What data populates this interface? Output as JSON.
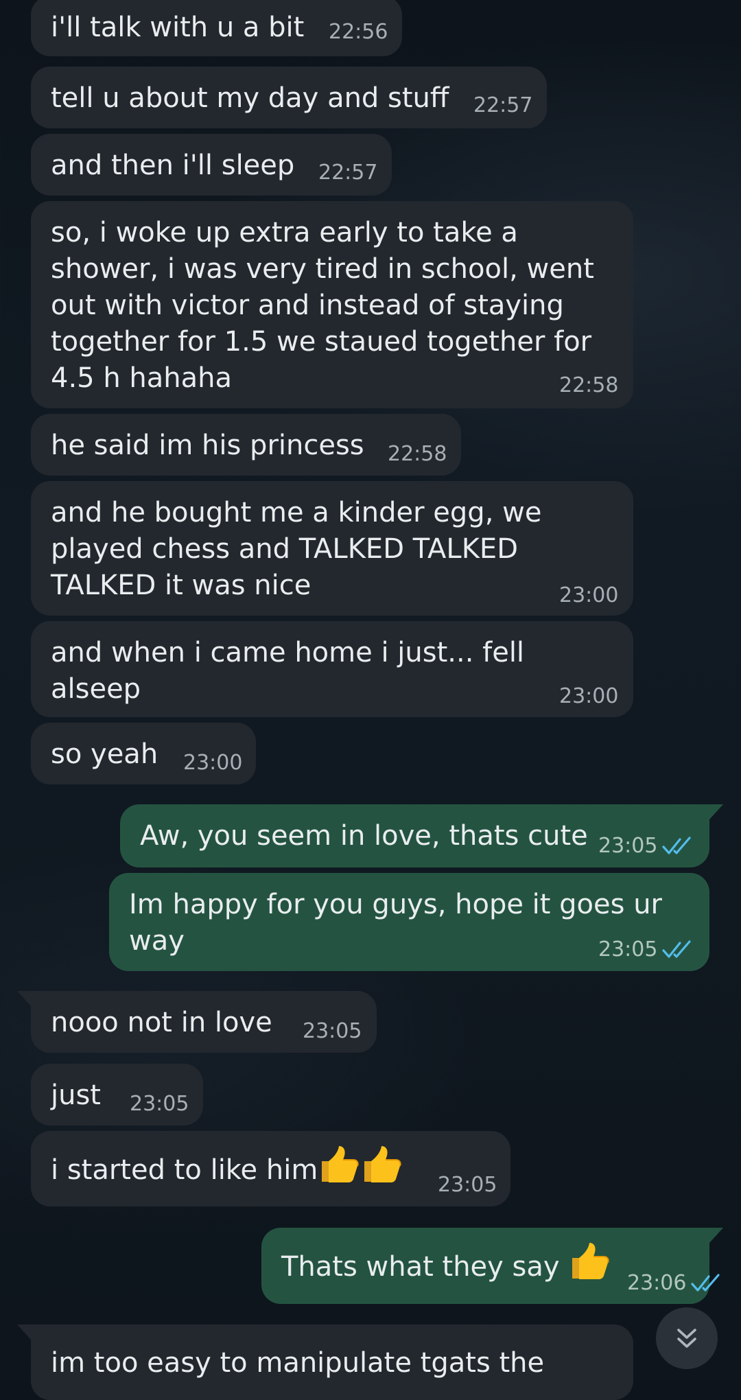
{
  "colors": {
    "incoming_bubble": "#23282e",
    "outgoing_bubble": "#245441",
    "read_ticks": "#53bdeb"
  },
  "messages": [
    {
      "text": "i'll talk with u a bit",
      "time": "22:56",
      "direction": "incoming"
    },
    {
      "text": "tell u about my day and stuff",
      "time": "22:57",
      "direction": "incoming"
    },
    {
      "text": "and then i'll sleep",
      "time": "22:57",
      "direction": "incoming"
    },
    {
      "text": "so, i woke up extra early to take a\nshower, i was very tired in school, went\nout with victor and instead of staying\ntogether for 1.5 we staued together for\n4.5 h hahaha",
      "time": "22:58",
      "direction": "incoming"
    },
    {
      "text": "he said im his princess",
      "time": "22:58",
      "direction": "incoming"
    },
    {
      "text": "and he bought me a kinder egg, we\nplayed chess and TALKED TALKED\nTALKED it was nice",
      "time": "23:00",
      "direction": "incoming"
    },
    {
      "text": "and when i came home i just... fell alseep",
      "time": "23:00",
      "direction": "incoming"
    },
    {
      "text": "so yeah",
      "time": "23:00",
      "direction": "incoming"
    },
    {
      "text": "Aw, you seem in love, thats cute",
      "time": "23:05",
      "direction": "outgoing",
      "status": "read"
    },
    {
      "text": "Im happy for you guys, hope it goes ur\nway",
      "time": "23:05",
      "direction": "outgoing",
      "status": "read"
    },
    {
      "text": "nooo not in love",
      "time": "23:05",
      "direction": "incoming"
    },
    {
      "text": "just",
      "time": "23:05",
      "direction": "incoming"
    },
    {
      "text": "i started to like him",
      "time": "23:05",
      "direction": "incoming",
      "emoji": "thumbs-up-icon x2"
    },
    {
      "text": "Thats what they say ",
      "time": "23:06",
      "direction": "outgoing",
      "status": "read",
      "emoji": "thumbs-up-icon"
    },
    {
      "text": "im too easy to manipulate tgats the",
      "direction": "incoming"
    }
  ],
  "scroll_button": {
    "icon": "double-chevron-down-icon"
  }
}
